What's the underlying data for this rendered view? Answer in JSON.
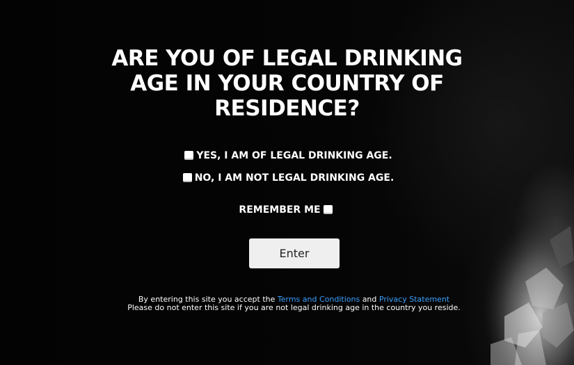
{
  "heading": "ARE YOU OF LEGAL DRINKING AGE IN YOUR COUNTRY OF RESIDENCE?",
  "options": {
    "yes_label": "YES, I AM OF LEGAL DRINKING AGE.",
    "no_label": "NO, I AM NOT LEGAL DRINKING AGE.",
    "yes_checked": false,
    "no_checked": false
  },
  "remember": {
    "label": "REMEMBER ME",
    "checked": false
  },
  "enter_button": {
    "label": "Enter"
  },
  "legal": {
    "prefix": "By entering this site you accept the",
    "terms_link": "Terms and Conditions",
    "conjunction": "and",
    "privacy_link": "Privacy Statement",
    "notice": "Please do not enter this site if you are not legal drinking age in the country you reside."
  },
  "colors": {
    "background": "#040404",
    "text": "#ffffff",
    "link": "#3aa0ff",
    "button_bg": "#efefef",
    "button_text": "#222222"
  },
  "icons": {
    "checkbox": "checkbox-unchecked-icon"
  }
}
